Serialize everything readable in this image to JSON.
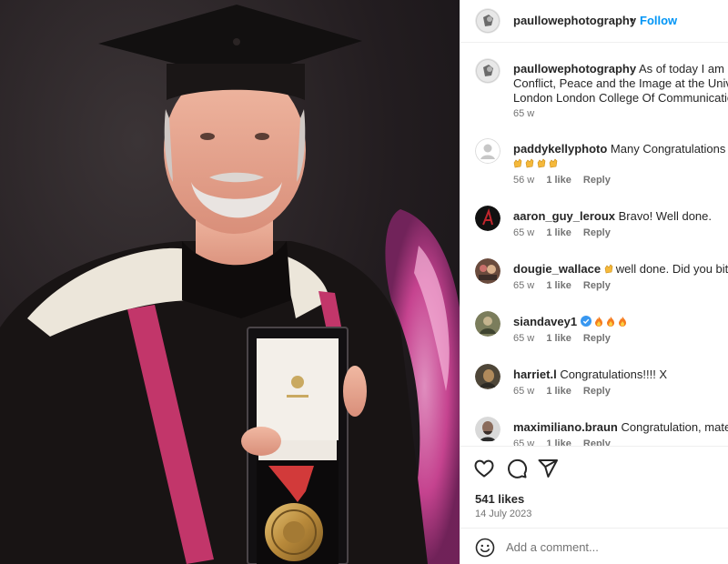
{
  "post": {
    "author": "paullowephotography",
    "separator": "•",
    "follow_label": "Follow",
    "photo_alt": "Man in graduation cap and gown holding a medal in an open presentation case"
  },
  "caption": {
    "username": "paullowephotography",
    "line1": "As of today I am off",
    "line2": "Conflict, Peace and the Image at the Univer",
    "line3": "London London College Of Communication",
    "time": "65 w"
  },
  "comments": [
    {
      "username": "paddykellyphoto",
      "text": "Many Congratulations Pa",
      "emoji": [
        "clap",
        "clap",
        "clap",
        "clap"
      ],
      "time": "56 w",
      "likes": "1 like",
      "reply": "Reply"
    },
    {
      "username": "aaron_guy_leroux",
      "text": "Bravo! Well done.",
      "time": "65 w",
      "likes": "1 like",
      "reply": "Reply"
    },
    {
      "username": "dougie_wallace",
      "text": "well done. Did you bite",
      "emoji": [
        "clap"
      ],
      "time": "65 w",
      "likes": "1 like",
      "reply": "Reply"
    },
    {
      "username": "siandavey1",
      "verified": true,
      "text": "",
      "emoji": [
        "fire",
        "fire",
        "fire"
      ],
      "time": "65 w",
      "likes": "1 like",
      "reply": "Reply"
    },
    {
      "username": "harriet.l",
      "text": "Congratulations!!!! X",
      "time": "65 w",
      "likes": "1 like",
      "reply": "Reply"
    },
    {
      "username": "maximiliano.braun",
      "text": "Congratulation, mate!",
      "time": "65 w",
      "likes": "1 like",
      "reply": "Reply"
    }
  ],
  "actions": {
    "like_icon": "heart-icon",
    "comment_icon": "comment-icon",
    "share_icon": "share-icon",
    "likes_count": "541 likes",
    "date": "14 July 2023"
  },
  "add_comment": {
    "placeholder": "Add a comment...",
    "icon": "smiley-icon"
  },
  "colors": {
    "link_blue": "#0095f6",
    "muted_text": "#737373",
    "verified_blue": "#3897f0"
  }
}
